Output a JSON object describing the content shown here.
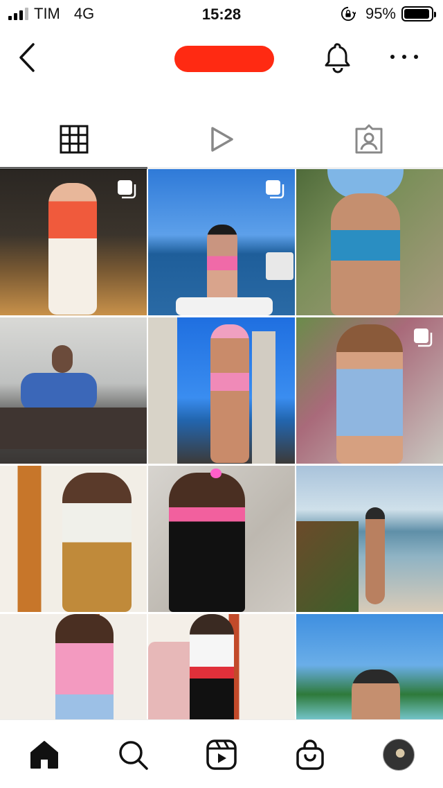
{
  "status_bar": {
    "carrier": "TIM",
    "network": "4G",
    "time": "15:28",
    "battery_text": "95%",
    "battery_level": 0.95,
    "icons": [
      "signal-icon",
      "rotation-lock-icon",
      "battery-icon"
    ]
  },
  "header": {
    "icons": [
      "back-icon",
      "bell-icon",
      "more-icon"
    ]
  },
  "tabs": [
    {
      "icon": "grid-icon",
      "active": true
    },
    {
      "icon": "reels-play-icon",
      "active": false
    },
    {
      "icon": "tagged-person-icon",
      "active": false
    }
  ],
  "bottom_nav": {
    "icons": [
      "home-icon",
      "search-icon",
      "reels-icon",
      "shop-icon",
      "profile-avatar"
    ]
  },
  "colors": {
    "redaction": "#ff2a12",
    "active_tab_indicator": "#111111"
  }
}
